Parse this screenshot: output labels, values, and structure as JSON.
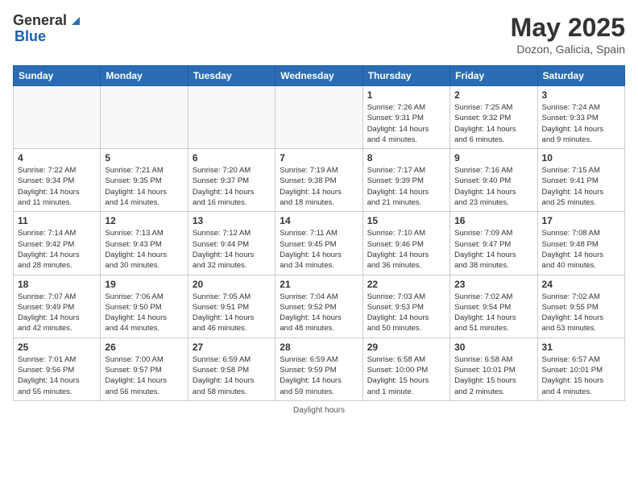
{
  "header": {
    "logo_general": "General",
    "logo_blue": "Blue",
    "title": "May 2025",
    "subtitle": "Dozon, Galicia, Spain"
  },
  "days_of_week": [
    "Sunday",
    "Monday",
    "Tuesday",
    "Wednesday",
    "Thursday",
    "Friday",
    "Saturday"
  ],
  "weeks": [
    [
      {
        "day": "",
        "info": "",
        "empty": true
      },
      {
        "day": "",
        "info": "",
        "empty": true
      },
      {
        "day": "",
        "info": "",
        "empty": true
      },
      {
        "day": "",
        "info": "",
        "empty": true
      },
      {
        "day": "1",
        "info": "Sunrise: 7:26 AM\nSunset: 9:31 PM\nDaylight: 14 hours\nand 4 minutes."
      },
      {
        "day": "2",
        "info": "Sunrise: 7:25 AM\nSunset: 9:32 PM\nDaylight: 14 hours\nand 6 minutes."
      },
      {
        "day": "3",
        "info": "Sunrise: 7:24 AM\nSunset: 9:33 PM\nDaylight: 14 hours\nand 9 minutes."
      }
    ],
    [
      {
        "day": "4",
        "info": "Sunrise: 7:22 AM\nSunset: 9:34 PM\nDaylight: 14 hours\nand 11 minutes."
      },
      {
        "day": "5",
        "info": "Sunrise: 7:21 AM\nSunset: 9:35 PM\nDaylight: 14 hours\nand 14 minutes."
      },
      {
        "day": "6",
        "info": "Sunrise: 7:20 AM\nSunset: 9:37 PM\nDaylight: 14 hours\nand 16 minutes."
      },
      {
        "day": "7",
        "info": "Sunrise: 7:19 AM\nSunset: 9:38 PM\nDaylight: 14 hours\nand 18 minutes."
      },
      {
        "day": "8",
        "info": "Sunrise: 7:17 AM\nSunset: 9:39 PM\nDaylight: 14 hours\nand 21 minutes."
      },
      {
        "day": "9",
        "info": "Sunrise: 7:16 AM\nSunset: 9:40 PM\nDaylight: 14 hours\nand 23 minutes."
      },
      {
        "day": "10",
        "info": "Sunrise: 7:15 AM\nSunset: 9:41 PM\nDaylight: 14 hours\nand 25 minutes."
      }
    ],
    [
      {
        "day": "11",
        "info": "Sunrise: 7:14 AM\nSunset: 9:42 PM\nDaylight: 14 hours\nand 28 minutes."
      },
      {
        "day": "12",
        "info": "Sunrise: 7:13 AM\nSunset: 9:43 PM\nDaylight: 14 hours\nand 30 minutes."
      },
      {
        "day": "13",
        "info": "Sunrise: 7:12 AM\nSunset: 9:44 PM\nDaylight: 14 hours\nand 32 minutes."
      },
      {
        "day": "14",
        "info": "Sunrise: 7:11 AM\nSunset: 9:45 PM\nDaylight: 14 hours\nand 34 minutes."
      },
      {
        "day": "15",
        "info": "Sunrise: 7:10 AM\nSunset: 9:46 PM\nDaylight: 14 hours\nand 36 minutes."
      },
      {
        "day": "16",
        "info": "Sunrise: 7:09 AM\nSunset: 9:47 PM\nDaylight: 14 hours\nand 38 minutes."
      },
      {
        "day": "17",
        "info": "Sunrise: 7:08 AM\nSunset: 9:48 PM\nDaylight: 14 hours\nand 40 minutes."
      }
    ],
    [
      {
        "day": "18",
        "info": "Sunrise: 7:07 AM\nSunset: 9:49 PM\nDaylight: 14 hours\nand 42 minutes."
      },
      {
        "day": "19",
        "info": "Sunrise: 7:06 AM\nSunset: 9:50 PM\nDaylight: 14 hours\nand 44 minutes."
      },
      {
        "day": "20",
        "info": "Sunrise: 7:05 AM\nSunset: 9:51 PM\nDaylight: 14 hours\nand 46 minutes."
      },
      {
        "day": "21",
        "info": "Sunrise: 7:04 AM\nSunset: 9:52 PM\nDaylight: 14 hours\nand 48 minutes."
      },
      {
        "day": "22",
        "info": "Sunrise: 7:03 AM\nSunset: 9:53 PM\nDaylight: 14 hours\nand 50 minutes."
      },
      {
        "day": "23",
        "info": "Sunrise: 7:02 AM\nSunset: 9:54 PM\nDaylight: 14 hours\nand 51 minutes."
      },
      {
        "day": "24",
        "info": "Sunrise: 7:02 AM\nSunset: 9:55 PM\nDaylight: 14 hours\nand 53 minutes."
      }
    ],
    [
      {
        "day": "25",
        "info": "Sunrise: 7:01 AM\nSunset: 9:56 PM\nDaylight: 14 hours\nand 55 minutes."
      },
      {
        "day": "26",
        "info": "Sunrise: 7:00 AM\nSunset: 9:57 PM\nDaylight: 14 hours\nand 56 minutes."
      },
      {
        "day": "27",
        "info": "Sunrise: 6:59 AM\nSunset: 9:58 PM\nDaylight: 14 hours\nand 58 minutes."
      },
      {
        "day": "28",
        "info": "Sunrise: 6:59 AM\nSunset: 9:59 PM\nDaylight: 14 hours\nand 59 minutes."
      },
      {
        "day": "29",
        "info": "Sunrise: 6:58 AM\nSunset: 10:00 PM\nDaylight: 15 hours\nand 1 minute."
      },
      {
        "day": "30",
        "info": "Sunrise: 6:58 AM\nSunset: 10:01 PM\nDaylight: 15 hours\nand 2 minutes."
      },
      {
        "day": "31",
        "info": "Sunrise: 6:57 AM\nSunset: 10:01 PM\nDaylight: 15 hours\nand 4 minutes."
      }
    ]
  ],
  "footer": "Daylight hours"
}
